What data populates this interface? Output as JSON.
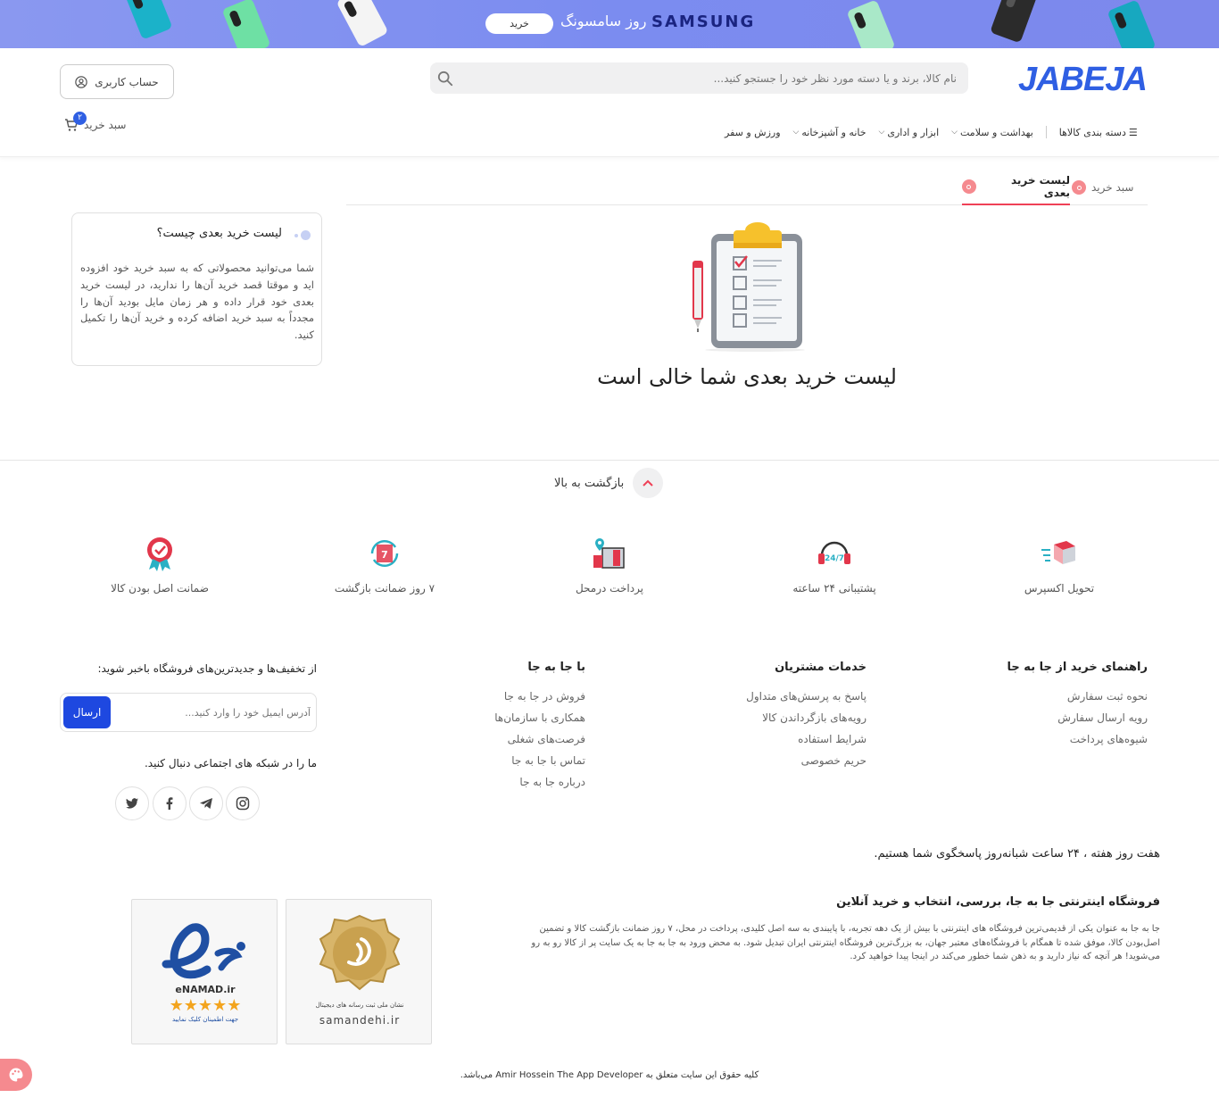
{
  "banner": {
    "brand": "SAMSUNG",
    "text": "روز سامسونگ",
    "button_label": "خرید",
    "background": "#7d8cef"
  },
  "header": {
    "logo_text": "JABEJA",
    "search_placeholder": "نام کالا، برند و یا دسته مورد نظر خود را جستجو کنید...",
    "account_label": "حساب کاربری",
    "cart_label": "سبد خرید",
    "cart_count": "۲",
    "accent": "#2f5fe3"
  },
  "nav": {
    "categories_label": "دسته بندی کالاها",
    "items": [
      {
        "label": "بهداشت و سلامت"
      },
      {
        "label": "ابزار و اداری"
      },
      {
        "label": "خانه و آشپزخانه"
      },
      {
        "label": "ورزش و سفر"
      }
    ]
  },
  "tabs": [
    {
      "label": "سبد خرید",
      "count": "۰"
    },
    {
      "label": "لیست خرید بعدی",
      "count": "۰"
    }
  ],
  "empty_state": {
    "title": "لیست خرید بعدی شما خالی است"
  },
  "info_box": {
    "title": "لیست خرید بعدی چیست؟",
    "body": "شما می‌توانید محصولاتی که به سبد خرید خود افزوده اید و موقتا قصد خرید آن‌ها را ندارید، در لیست خرید بعدی خود قرار داده و هر زمان مایل بودید آن‌ها را مجدداً به سبد خرید اضافه کرده و خرید آن‌ها را تکمیل کنید."
  },
  "back_to_top": "بازگشت به بالا",
  "features": [
    {
      "label": "تحویل اکسپرس",
      "icon": "express-delivery-icon"
    },
    {
      "label": "پشتیبانی ۲۴ ساعته",
      "icon": "support-24-icon"
    },
    {
      "label": "پرداخت درمحل",
      "icon": "cash-on-delivery-icon"
    },
    {
      "label": "۷ روز ضمانت بازگشت",
      "icon": "return-guarantee-icon"
    },
    {
      "label": "ضمانت اصل بودن کالا",
      "icon": "original-guarantee-icon"
    }
  ],
  "footer": {
    "columns": [
      {
        "title": "راهنمای خرید از جا به جا",
        "links": [
          "نحوه ثبت سفارش",
          "رویه ارسال سفارش",
          "شیوه‌های پرداخت"
        ]
      },
      {
        "title": "خدمات مشتریان",
        "links": [
          "پاسخ به پرسش‌های متداول",
          "رویه‌های بازگرداندن کالا",
          "شرایط استفاده",
          "حریم خصوصی"
        ]
      },
      {
        "title": "با جا به جا",
        "links": [
          "فروش در جا به جا",
          "همکاری با سازمان‌ها",
          "فرصت‌های شغلی",
          "تماس با جا به جا",
          "درباره جا به جا"
        ]
      }
    ],
    "newsletter_title": "از تخفیف‌ها و جدیدترین‌های فروشگاه باخبر شوید:",
    "newsletter_placeholder": "آدرس ایمیل خود را وارد کنید...",
    "send_label": "ارسال",
    "social_title": "ما را در شبکه های اجتماعی دنبال کنید.",
    "social_icons": [
      "instagram-icon",
      "telegram-icon",
      "facebook-icon",
      "twitter-icon"
    ],
    "support_line": "هفت روز هفته ، ۲۴ ساعت شبانه‌روز پاسخگوی شما هستیم.",
    "about_title": "فروشگاه اینترنتی جا به جا، بررسی، انتخاب و خرید آنلاین",
    "about_body": "جا به جا به عنوان یکی از قدیمی‌ترین فروشگاه های اینترنتی با بیش از یک دهه تجربه، با پایبندی به سه اصل کلیدی، پرداخت در محل، ۷ روز ضمانت بازگشت کالا و تضمین اصل‌بودن کالا، موفق شده تا همگام با فروشگاه‌های معتبر جهان، به بزرگ‌ترین فروشگاه اینترنتی ایران تبدیل شود. به محض ورود به جا به جا به یک سایت پر از کالا رو به رو می‌شوید! هر آنچه که نیاز دارید و به ذهن شما خطور می‌کند در اینجا پیدا خواهید کرد.",
    "trust_badges": [
      {
        "name": "samandehi",
        "caption": "samandehi.ir",
        "sub": "نشان ملی ثبت رسانه های دیجیتال"
      },
      {
        "name": "enamad",
        "caption": "eNAMAD.ir",
        "sub": "جهت اطمینان کلیک نمایید"
      }
    ],
    "copyright": "کلیه حقوق این سایت متعلق به Amir Hossein The App Developer می‌باشد."
  }
}
